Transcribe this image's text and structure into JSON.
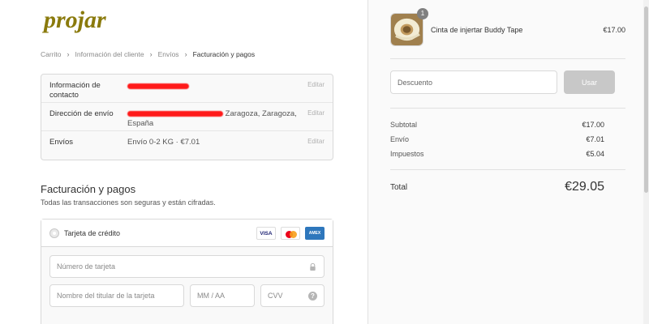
{
  "brand": {
    "logo_text": "projar",
    "logo_color": "#8a7a0c"
  },
  "breadcrumb": {
    "items": [
      "Carrito",
      "Información del cliente",
      "Envíos"
    ],
    "current": "Facturación y pagos"
  },
  "review": {
    "contact": {
      "label": "Información de contacto",
      "value": "",
      "edit": "Editar"
    },
    "shipping_address": {
      "label": "Dirección de envío",
      "value_suffix": "Zaragoza, Zaragoza,",
      "value_line2": "España",
      "edit": "Editar"
    },
    "shipping": {
      "label": "Envíos",
      "value": "Envío 0-2 KG · €7.01",
      "edit": "Editar"
    }
  },
  "billing": {
    "title": "Facturación y pagos",
    "subtitle": "Todas las transacciones son seguras y están cifradas.",
    "method_label": "Tarjeta de crédito",
    "cards": {
      "visa": "VISA",
      "amex": "AMEX"
    },
    "fields": {
      "card_number": "Número de tarjeta",
      "card_name": "Nombre del titular de la tarjeta",
      "expiry": "MM / AA",
      "cvv": "CVV"
    }
  },
  "order": {
    "product": {
      "name": "Cinta de injertar Buddy Tape",
      "price": "€17.00",
      "quantity": "1"
    },
    "discount": {
      "placeholder": "Descuento",
      "button": "Usar"
    },
    "summary": [
      {
        "label": "Subtotal",
        "value": "€17.00"
      },
      {
        "label": "Envío",
        "value": "€7.01"
      },
      {
        "label": "Impuestos",
        "value": "€5.04"
      }
    ],
    "total": {
      "label": "Total",
      "value": "€29.05"
    }
  }
}
